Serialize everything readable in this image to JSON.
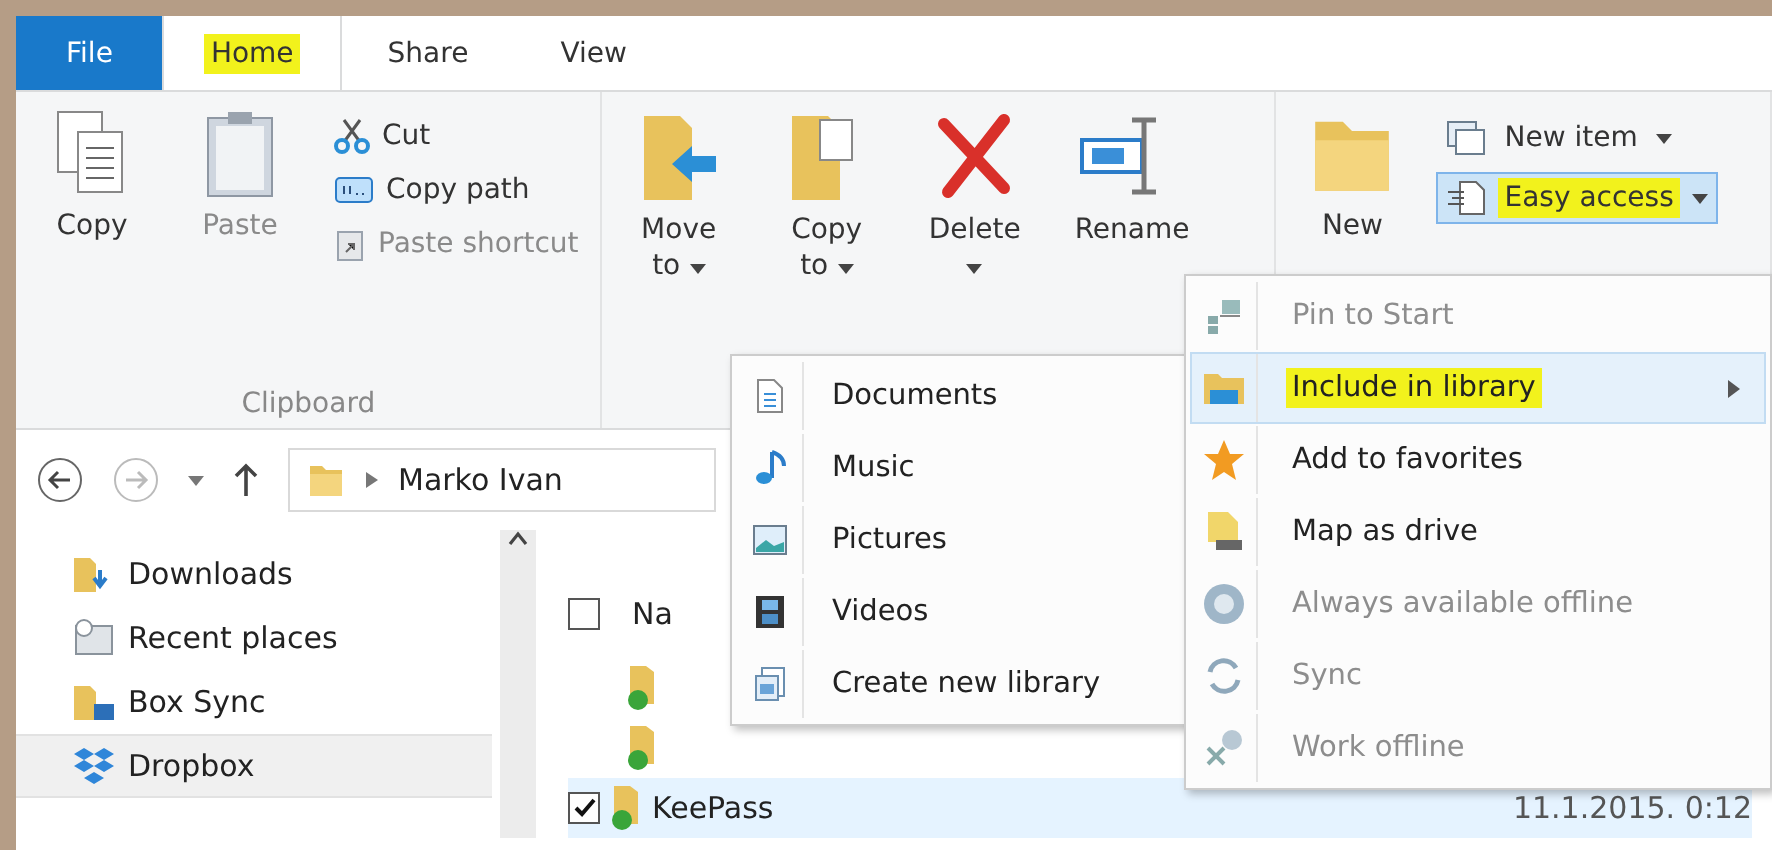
{
  "tabs": [
    {
      "label": "File",
      "kind": "file",
      "selected": false,
      "highlighted": false
    },
    {
      "label": "Home",
      "kind": "tab",
      "selected": true,
      "highlighted": true
    },
    {
      "label": "Share",
      "kind": "tab",
      "selected": false,
      "highlighted": false
    },
    {
      "label": "View",
      "kind": "tab",
      "selected": false,
      "highlighted": false
    }
  ],
  "ribbon": {
    "clipboard": {
      "label": "Clipboard",
      "large": [
        {
          "label": "Copy",
          "disabled": false
        },
        {
          "label": "Paste",
          "disabled": true
        }
      ],
      "small": [
        {
          "label": "Cut",
          "disabled": false
        },
        {
          "label": "Copy path",
          "disabled": false
        },
        {
          "label": "Paste shortcut",
          "disabled": true
        }
      ]
    },
    "organize": {
      "large": [
        {
          "label": "Move to",
          "caret": true
        },
        {
          "label": "Copy to",
          "caret": true
        },
        {
          "label": "Delete",
          "caret": true
        },
        {
          "label": "Rename",
          "caret": false
        }
      ]
    },
    "new": {
      "large": [
        {
          "label": "New"
        }
      ],
      "small": [
        {
          "label": "New item",
          "caret": true,
          "highlighted": false
        },
        {
          "label": "Easy access",
          "caret": true,
          "highlighted": true
        }
      ]
    }
  },
  "address": {
    "path": "Marko Ivan"
  },
  "sidebar": {
    "items": [
      {
        "label": "Downloads",
        "selected": false
      },
      {
        "label": "Recent places",
        "selected": false
      },
      {
        "label": "Box Sync",
        "selected": false
      },
      {
        "label": "Dropbox",
        "selected": true
      }
    ]
  },
  "file_list": {
    "header": {
      "label": "Na",
      "checked": false
    },
    "rows": [
      {
        "checked": false
      },
      {
        "checked": false
      },
      {
        "name": "KeePass",
        "checked": true,
        "date": "11.1.2015. 0:12"
      }
    ]
  },
  "library_menu": {
    "items": [
      {
        "label": "Documents"
      },
      {
        "label": "Music"
      },
      {
        "label": "Pictures"
      },
      {
        "label": "Videos"
      },
      {
        "label": "Create new library"
      }
    ]
  },
  "easy_access_menu": {
    "items": [
      {
        "label": "Pin to Start",
        "disabled": true,
        "highlighted": false,
        "submenu": false
      },
      {
        "label": "Include in library",
        "disabled": false,
        "highlighted": true,
        "submenu": true
      },
      {
        "label": "Add to favorites",
        "disabled": false,
        "highlighted": false,
        "submenu": false
      },
      {
        "label": "Map as drive",
        "disabled": false,
        "highlighted": false,
        "submenu": false
      },
      {
        "label": "Always available offline",
        "disabled": true,
        "highlighted": false,
        "submenu": false
      },
      {
        "label": "Sync",
        "disabled": true,
        "highlighted": false,
        "submenu": false
      },
      {
        "label": "Work offline",
        "disabled": true,
        "highlighted": false,
        "submenu": false
      }
    ]
  }
}
